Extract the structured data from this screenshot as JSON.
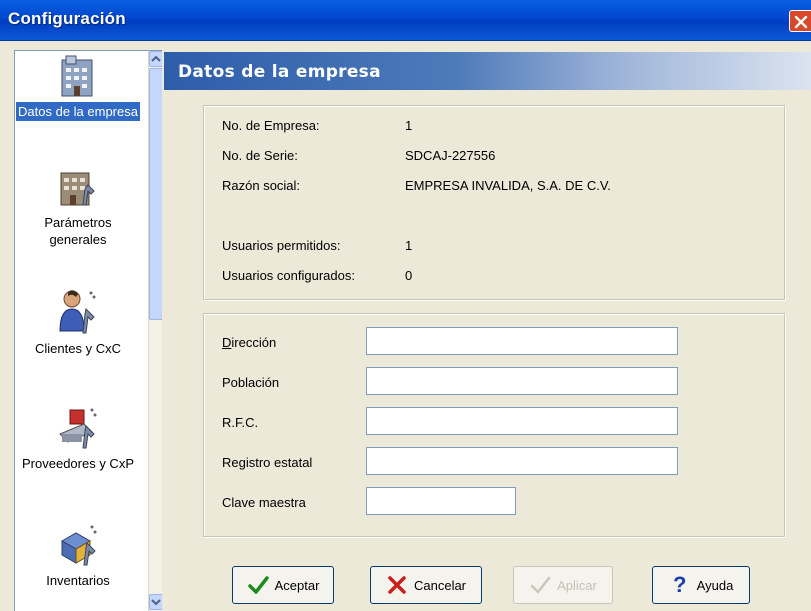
{
  "window": {
    "title": "Configuración"
  },
  "sidebar": {
    "items": [
      {
        "label": "Datos de la empresa",
        "icon": "building-icon",
        "selected": true
      },
      {
        "label": "Parámetros generales",
        "icon": "building-wrench-icon",
        "selected": false
      },
      {
        "label": "Clientes y CxC",
        "icon": "person-wrench-icon",
        "selected": false
      },
      {
        "label": "Proveedores y CxP",
        "icon": "truck-wrench-icon",
        "selected": false
      },
      {
        "label": "Inventarios",
        "icon": "box-wrench-icon",
        "selected": false
      }
    ]
  },
  "panel": {
    "title": "Datos de la empresa",
    "info": [
      {
        "label": "No. de Empresa:",
        "value": "1"
      },
      {
        "label": "No. de Serie:",
        "value": "SDCAJ-227556"
      },
      {
        "label": "Razón social:",
        "value": "EMPRESA INVALIDA, S.A. DE C.V."
      },
      {
        "label": "Usuarios permitidos:",
        "value": "1"
      },
      {
        "label": "Usuarios configurados:",
        "value": "0"
      }
    ],
    "fields": [
      {
        "label": "Dirección",
        "value": "",
        "placeholder": ""
      },
      {
        "label": "Población",
        "value": "",
        "placeholder": ""
      },
      {
        "label": "R.F.C.",
        "value": "",
        "placeholder": ""
      },
      {
        "label": "Registro estatal",
        "value": "",
        "placeholder": ""
      },
      {
        "label": "Clave maestra",
        "value": "",
        "placeholder": ""
      }
    ]
  },
  "buttons": {
    "accept": "Aceptar",
    "cancel": "Cancelar",
    "apply": "Aplicar",
    "help": "Ayuda"
  },
  "colors": {
    "title_bar": "#0a5fe0",
    "selection": "#316ac5",
    "header_gradient_start": "#2e5daa"
  }
}
